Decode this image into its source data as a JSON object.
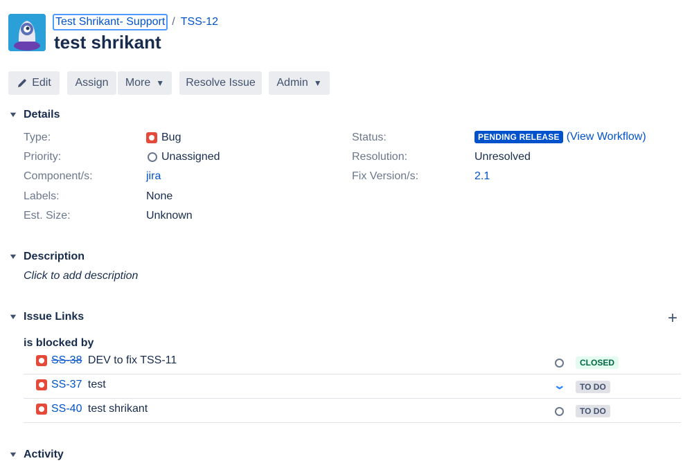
{
  "breadcrumb": {
    "project": "Test Shrikant- Support",
    "separator": "/",
    "issue_key": "TSS-12"
  },
  "issue": {
    "title": "test shrikant"
  },
  "toolbar": {
    "edit": "Edit",
    "assign": "Assign",
    "more": "More",
    "resolve": "Resolve Issue",
    "admin": "Admin"
  },
  "details": {
    "heading": "Details",
    "type": {
      "label": "Type:",
      "value": "Bug"
    },
    "priority": {
      "label": "Priority:",
      "value": "Unassigned"
    },
    "components": {
      "label": "Component/s:",
      "value": "jira"
    },
    "labels": {
      "label": "Labels:",
      "value": "None"
    },
    "est_size": {
      "label": "Est. Size:",
      "value": "Unknown"
    },
    "status": {
      "label": "Status:",
      "value": "PENDING RELEASE",
      "workflow_link": "(View Workflow)"
    },
    "resolution": {
      "label": "Resolution:",
      "value": "Unresolved"
    },
    "fix_versions": {
      "label": "Fix Version/s:",
      "value": "2.1"
    }
  },
  "description": {
    "heading": "Description",
    "placeholder": "Click to add description"
  },
  "issue_links": {
    "heading": "Issue Links",
    "relation": "is blocked by",
    "links": [
      {
        "key": "SS-38",
        "summary": "DEV to fix TSS-11",
        "status": "CLOSED",
        "resolved": true
      },
      {
        "key": "SS-37",
        "summary": "test",
        "status": "TO DO",
        "resolved": false
      },
      {
        "key": "SS-40",
        "summary": "test shrikant",
        "status": "TO DO",
        "resolved": false
      }
    ]
  },
  "activity": {
    "heading": "Activity"
  },
  "colors": {
    "link": "#0052cc",
    "bug": "#e5493a",
    "status_blue": "#0052cc",
    "closed_green": "#006644"
  },
  "icons": [
    "project-avatar-icon",
    "pencil-icon",
    "chevron-down-icon",
    "bug-icon",
    "priority-unassigned-icon",
    "priority-low-icon",
    "add-icon"
  ]
}
